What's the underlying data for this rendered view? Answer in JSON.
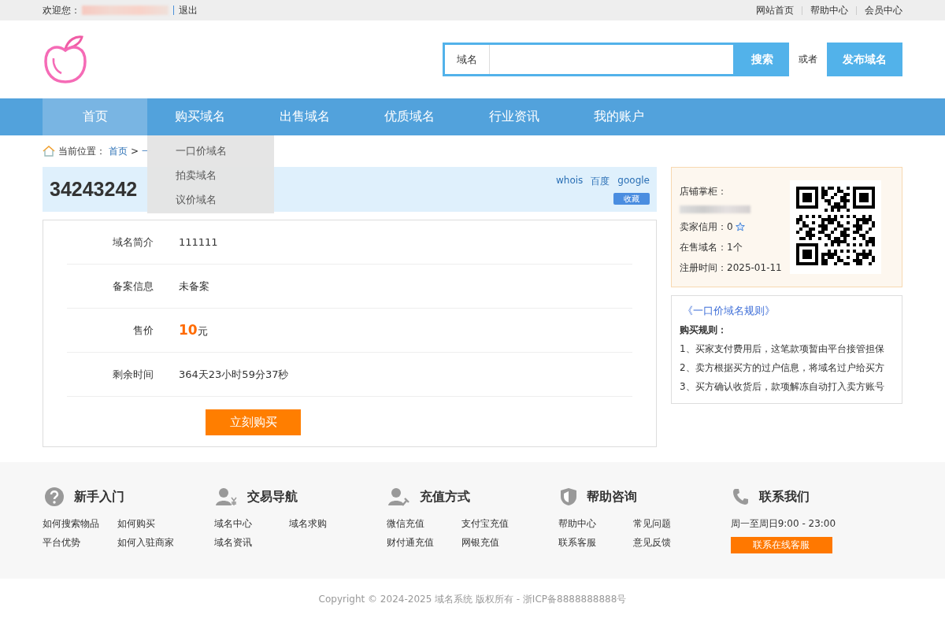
{
  "top_bar": {
    "welcome": "欢迎您：",
    "logout": "退出",
    "links": [
      "网站首页",
      "帮助中心",
      "会员中心"
    ]
  },
  "header": {
    "search": {
      "category": "域名",
      "button": "搜索"
    },
    "or": "或者",
    "publish_button": "发布域名"
  },
  "nav": {
    "items": [
      {
        "label": "首页",
        "selected": true
      },
      {
        "label": "购买域名",
        "selected": false
      },
      {
        "label": "出售域名",
        "selected": false
      },
      {
        "label": "优质域名",
        "selected": false
      },
      {
        "label": "行业资讯",
        "selected": false
      },
      {
        "label": "我的账户",
        "selected": false
      }
    ],
    "dropdown": {
      "items": [
        "一口价域名",
        "拍卖域名",
        "议价域名"
      ]
    }
  },
  "breadcrumb": {
    "label": "当前位置：",
    "links": [
      "首页",
      "一"
    ],
    "separator": ">"
  },
  "domain": {
    "name": "34243242",
    "links": [
      "whois",
      "百度",
      "google"
    ],
    "favorite_button": "收藏"
  },
  "details": {
    "rows": [
      {
        "kind": "text",
        "label": "域名简介",
        "value": "111111"
      },
      {
        "kind": "text",
        "label": "备案信息",
        "value": "未备案"
      },
      {
        "kind": "price",
        "label": "售价",
        "amount": "10",
        "unit": "元"
      },
      {
        "kind": "text",
        "label": "剩余时间",
        "value": "364天23小时59分37秒"
      }
    ],
    "buy_button": "立刻购买"
  },
  "seller": {
    "owner_label": "店铺掌柜：",
    "credit_label": "卖家信用：",
    "credit": "0",
    "listed_label": "在售域名：",
    "listed": "1个",
    "registered_label": "注册时间：",
    "registered": "2025-01-11"
  },
  "rules": {
    "title": "《一口价域名规则》",
    "heading": "购买规则：",
    "items": [
      "1、买家支付费用后，这笔款项暂由平台接管担保",
      "2、卖方根据买方的过户信息，将域名过户给买方",
      "3、买方确认收货后，款项解冻自动打入卖方账号"
    ]
  },
  "footer": {
    "columns": [
      {
        "kind": "links",
        "title": "新手入门",
        "links": [
          "如何搜索物品",
          "如何购买",
          "平台优势",
          "如何入驻商家"
        ]
      },
      {
        "kind": "links",
        "title": "交易导航",
        "links": [
          "域名中心",
          "域名求购",
          "域名资讯"
        ]
      },
      {
        "kind": "links",
        "title": "充值方式",
        "links": [
          "微信充值",
          "支付宝充值",
          "财付通充值",
          "网银充值"
        ]
      },
      {
        "kind": "links",
        "title": "帮助咨询",
        "links": [
          "帮助中心",
          "常见问题",
          "联系客服",
          "意见反馈"
        ]
      },
      {
        "kind": "contact",
        "title": "联系我们",
        "hours": "周一至周日9:00 - 23:00",
        "button": "联系在线客服"
      }
    ]
  },
  "copyright": "Copyright © 2024-2025 域名系统 版权所有 - 浙ICP备8888888888号"
}
